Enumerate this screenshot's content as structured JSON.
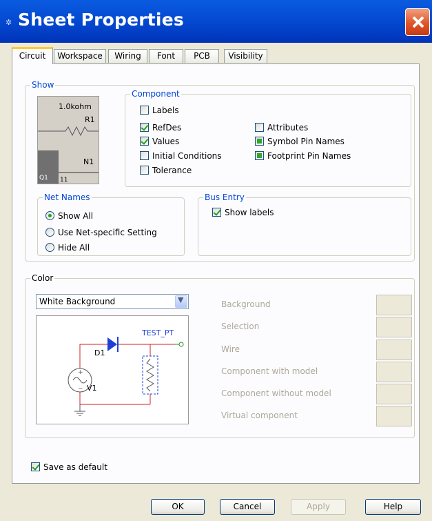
{
  "window": {
    "title": "Sheet Properties",
    "title_icon": "gear-icon",
    "close_icon": "close-icon"
  },
  "tabs": [
    {
      "label": "Circuit",
      "active": true
    },
    {
      "label": "Workspace",
      "active": false
    },
    {
      "label": "Wiring",
      "active": false
    },
    {
      "label": "Font",
      "active": false
    },
    {
      "label": "PCB",
      "active": false
    },
    {
      "label": "Visibility",
      "active": false
    }
  ],
  "show": {
    "legend": "Show",
    "preview": {
      "value_text": "1.0kohm",
      "refdes_r": "R1",
      "n_text": "N1",
      "q_text": "Q1",
      "pin_text": "11"
    }
  },
  "component": {
    "legend": "Component",
    "labels": {
      "label": "Labels",
      "checked": false
    },
    "refdes": {
      "label": "RefDes",
      "checked": true
    },
    "values": {
      "label": "Values",
      "checked": true
    },
    "initial_conditions": {
      "label": "Initial Conditions",
      "checked": false
    },
    "tolerance": {
      "label": "Tolerance",
      "checked": false
    },
    "attributes": {
      "label": "Attributes",
      "checked": false
    },
    "symbol_pin_names": {
      "label": "Symbol Pin Names",
      "state": "indeterminate"
    },
    "footprint_pin_names": {
      "label": "Footprint Pin Names",
      "state": "indeterminate"
    }
  },
  "net_names": {
    "legend": "Net Names",
    "options": [
      {
        "label": "Show All",
        "selected": true
      },
      {
        "label": "Use Net-specific Setting",
        "selected": false
      },
      {
        "label": "Hide All",
        "selected": false
      }
    ]
  },
  "bus_entry": {
    "legend": "Bus Entry",
    "show_labels": {
      "label": "Show labels",
      "checked": true
    }
  },
  "color": {
    "legend": "Color",
    "scheme_selected": "White Background",
    "schematic": {
      "test_pt": "TEST_PT",
      "d1": "D1",
      "v1": "V1"
    },
    "items": [
      {
        "label": "Background"
      },
      {
        "label": "Selection"
      },
      {
        "label": "Wire"
      },
      {
        "label": "Component with model"
      },
      {
        "label": "Component without model"
      },
      {
        "label": "Virtual component"
      }
    ]
  },
  "save_default": {
    "label": "Save as default",
    "checked": true
  },
  "buttons": {
    "ok": "OK",
    "cancel": "Cancel",
    "apply": "Apply",
    "help": "Help"
  },
  "colors": {
    "title_blue": "#0347CF",
    "legend_blue": "#0046D5",
    "check_green": "#21A121",
    "wire_red": "#D02020",
    "diode_blue": "#1E3FD8",
    "dialog_bg": "#ECE9D8"
  }
}
